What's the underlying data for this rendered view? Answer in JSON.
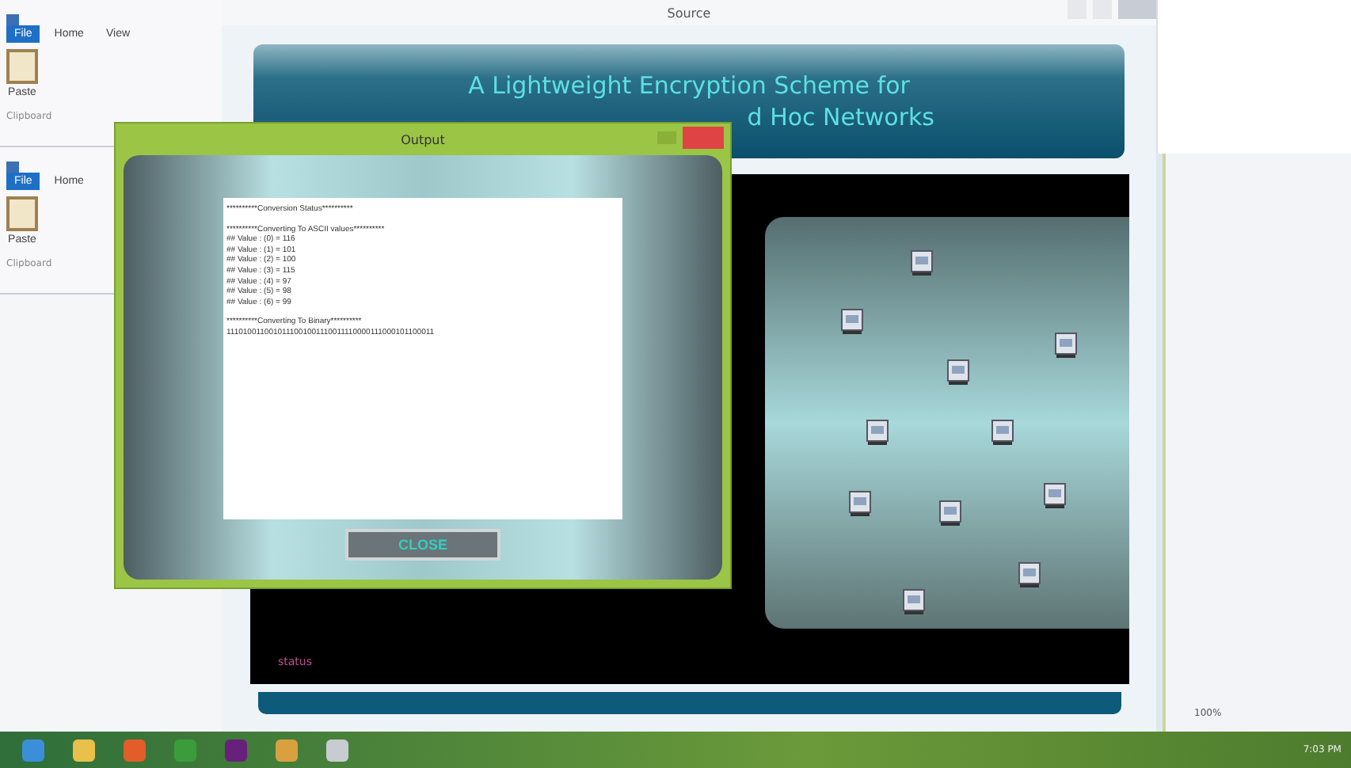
{
  "paint_windows": [
    {
      "tabs": [
        {
          "label": "File",
          "selected": true
        },
        {
          "label": "Home",
          "selected": false
        },
        {
          "label": "View",
          "selected": false
        }
      ],
      "paste_label": "Paste",
      "group_label": "Clipboard"
    },
    {
      "tabs": [
        {
          "label": "File",
          "selected": true
        },
        {
          "label": "Home",
          "selected": false
        }
      ],
      "paste_label": "Paste",
      "group_label": "Clipboard"
    }
  ],
  "paint_status": {
    "zoom": "100%"
  },
  "main_window": {
    "title": "Source",
    "banner_lines": [
      "A Lightweight Encryption Scheme for",
      "d Hoc Networks"
    ],
    "status": "status"
  },
  "output_dialog": {
    "title": "Output",
    "blocks": [
      [
        "**********Conversion Status**********"
      ],
      [
        "**********Converting To ASCII values**********",
        "## Value : (0) = 116",
        "## Value : (1) = 101",
        "## Value : (2) = 100",
        "## Value : (3) = 115",
        "## Value : (4) = 97",
        "## Value : (5) = 98",
        "## Value : (6) = 99"
      ],
      [
        "**********Converting To Binary**********",
        "1110100110010111001001110011110000111000101100011"
      ]
    ],
    "close_label": "CLOSE"
  },
  "taskbar": {
    "clock": "7:03 PM"
  }
}
